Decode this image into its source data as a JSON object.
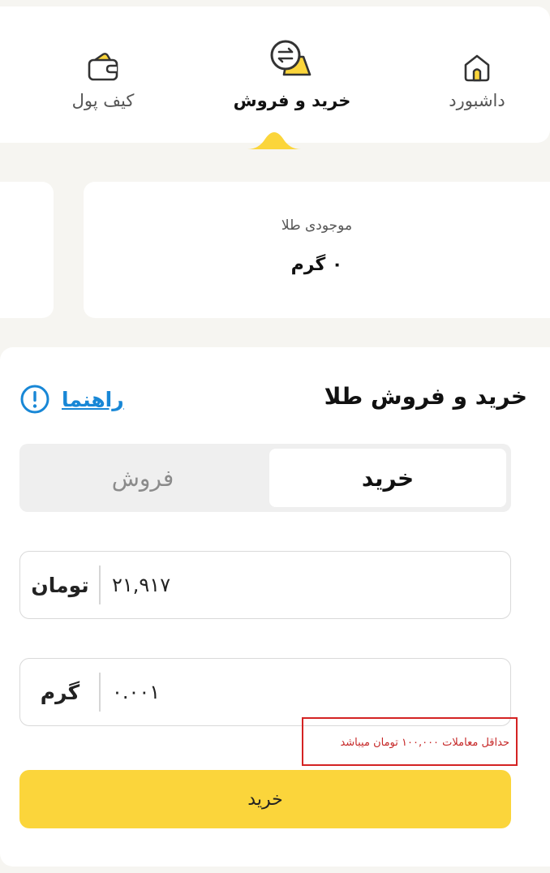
{
  "nav": {
    "items": [
      {
        "label": "داشبورد",
        "icon": "home-icon"
      },
      {
        "label": "خرید و فروش",
        "icon": "exchange-icon"
      },
      {
        "label": "کیف پول",
        "icon": "wallet-icon"
      }
    ],
    "active_index": 1,
    "accent_color": "#fbd53b"
  },
  "balance": {
    "title": "موجودی طلا",
    "value": "۰ گرم"
  },
  "trade": {
    "title": "خرید و فروش طلا",
    "help_label": "راهنما",
    "tabs": {
      "buy": "خرید",
      "sell": "فروش"
    },
    "selected_tab": "buy",
    "toman_field": {
      "value": "۲۱,۹۱۷",
      "unit": "تومان"
    },
    "gram_field": {
      "value": "۰.۰۰۱",
      "unit": "گرم"
    },
    "error_message": "حداقل معاملات ۱۰۰,۰۰۰ تومان میباشد",
    "submit_label": "خرید"
  },
  "colors": {
    "primary_yellow": "#fbd53b",
    "link_blue": "#1887d6",
    "error_red": "#d42323"
  }
}
